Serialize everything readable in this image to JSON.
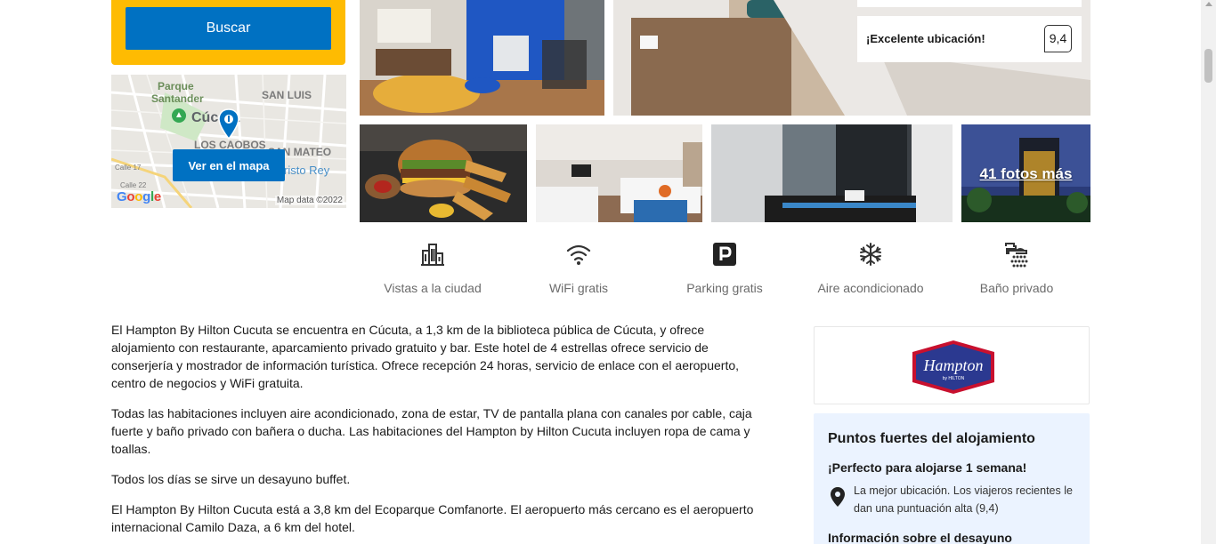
{
  "search": {
    "button_label": "Buscar"
  },
  "map": {
    "button_label": "Ver en el mapa",
    "labels": {
      "parque": "Parque",
      "santander": "Santander",
      "san_luis": "SAN LUIS",
      "city": "Cúcuta",
      "los_caobos": "LOS CAOBOS",
      "san_mateo": "SAN MATEO",
      "cristo_rey": "risto Rey",
      "calle17": "Calle 17",
      "calle22": "Calle 22"
    },
    "google": "Google",
    "credit": "Map data ©2022"
  },
  "gallery": {
    "rating_label": "¡Excelente ubicación!",
    "rating_score": "9,4",
    "more_photos": "41 fotos más"
  },
  "facilities": [
    {
      "icon": "city-view-icon",
      "label": "Vistas a la ciudad"
    },
    {
      "icon": "wifi-icon",
      "label": "WiFi gratis"
    },
    {
      "icon": "parking-icon",
      "label": "Parking gratis"
    },
    {
      "icon": "snowflake-icon",
      "label": "Aire acondicionado"
    },
    {
      "icon": "shower-icon",
      "label": "Baño privado"
    }
  ],
  "description": [
    "El Hampton By Hilton Cucuta se encuentra en Cúcuta, a 1,3 km de la biblioteca pública de Cúcuta, y ofrece alojamiento con restaurante, aparcamiento privado gratuito y bar. Este hotel de 4 estrellas ofrece servicio de conserjería y mostrador de información turística. Ofrece recepción 24 horas, servicio de enlace con el aeropuerto, centro de negocios y WiFi gratuita.",
    "Todas las habitaciones incluyen aire acondicionado, zona de estar, TV de pantalla plana con canales por cable, caja fuerte y baño privado con bañera o ducha. Las habitaciones del Hampton by Hilton Cucuta incluyen ropa de cama y toallas.",
    "Todos los días se sirve un desayuno buffet.",
    "El Hampton By Hilton Cucuta está a 3,8 km del Ecoparque Comfanorte. El aeropuerto más cercano es el aeropuerto internacional Camilo Daza, a 6 km del hotel."
  ],
  "brand": {
    "name": "Hampton",
    "sub": "by HILTON"
  },
  "highlights": {
    "title": "Puntos fuertes del alojamiento",
    "subtitle": "¡Perfecto para alojarse 1 semana!",
    "location_text": "La mejor ubicación. Los viajeros recientes le dan una puntuación alta (9,4)",
    "breakfast_title": "Información sobre el desayuno"
  },
  "colors": {
    "accent": "#0071c2",
    "search_bg": "#febb02",
    "highlight_bg": "#ebf3ff",
    "hampton": "#2b3990"
  }
}
